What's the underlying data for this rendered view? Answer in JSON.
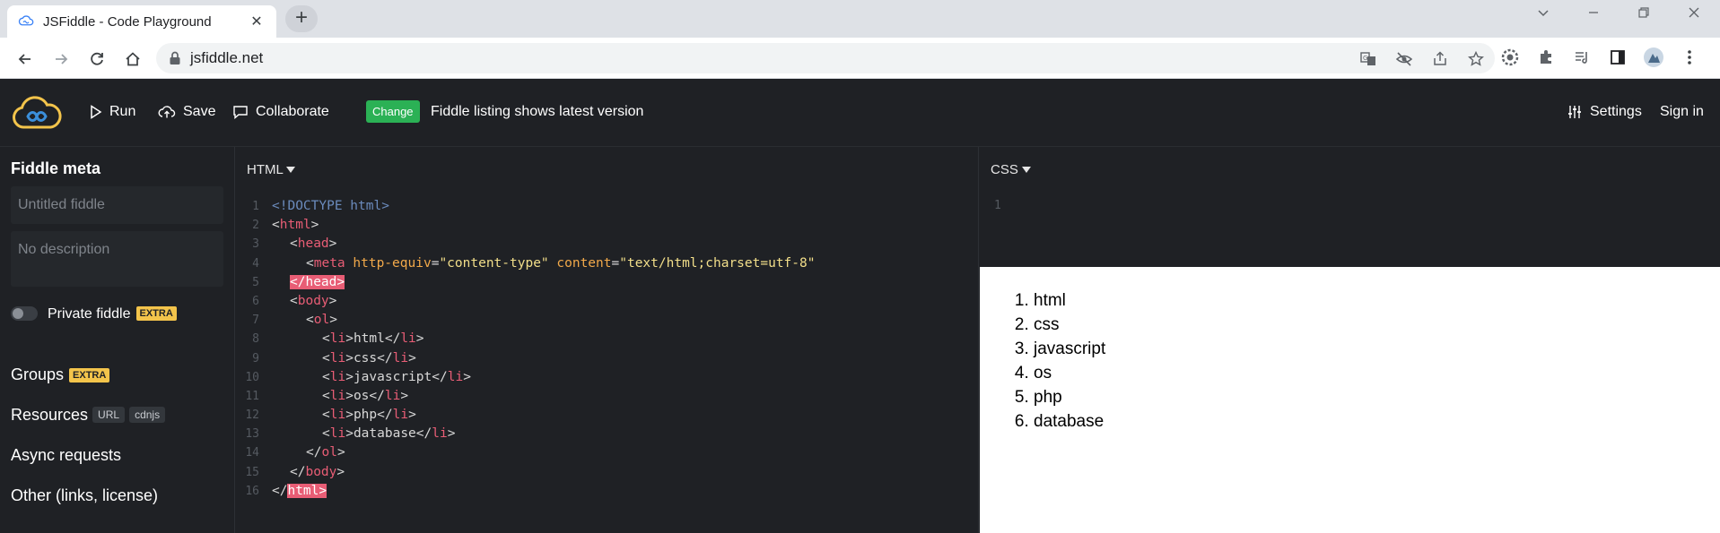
{
  "browser": {
    "tab_title": "JSFiddle - Code Playground",
    "tab_close": "✕",
    "new_tab": "+",
    "url": "jsfiddle.net"
  },
  "header": {
    "run_label": "Run",
    "save_label": "Save",
    "collaborate_label": "Collaborate",
    "change_badge": "Change",
    "notice": "Fiddle listing shows latest version",
    "settings_label": "Settings",
    "signin_label": "Sign in"
  },
  "sidebar": {
    "title": "Fiddle meta",
    "title_placeholder": "Untitled fiddle",
    "description_placeholder": "No description",
    "private_label": "Private fiddle",
    "extra_badge": "EXTRA",
    "groups_label": "Groups",
    "resources_label": "Resources",
    "resources_chips": [
      "URL",
      "cdnjs"
    ],
    "async_label": "Async requests",
    "other_label": "Other (links, license)"
  },
  "html_panel": {
    "title": "HTML",
    "line_numbers": [
      "1",
      "2",
      "3",
      "4",
      "5",
      "6",
      "7",
      "8",
      "9",
      "10",
      "11",
      "12",
      "13",
      "14",
      "15",
      "16"
    ],
    "tokens": {
      "doctype": "<!DOCTYPE html>",
      "lt": "<",
      "gt": ">",
      "lt_slash": "</",
      "html": "html",
      "head": "head",
      "meta": "meta",
      "http_equiv": "http-equiv",
      "eq": "=",
      "http_equiv_val": "\"content-type\"",
      "content_attr": "content",
      "content_val": "\"text/html;charset=utf-8\"",
      "head_close_err": "</head>",
      "body": "body",
      "ol": "ol",
      "li": "li",
      "html_err": "html>",
      "items": [
        "html",
        "css",
        "javascript",
        "os",
        "php",
        "database"
      ]
    }
  },
  "css_panel": {
    "title": "CSS",
    "line_number": "1"
  },
  "result": {
    "items": [
      "html",
      "css",
      "javascript",
      "os",
      "php",
      "database"
    ]
  }
}
